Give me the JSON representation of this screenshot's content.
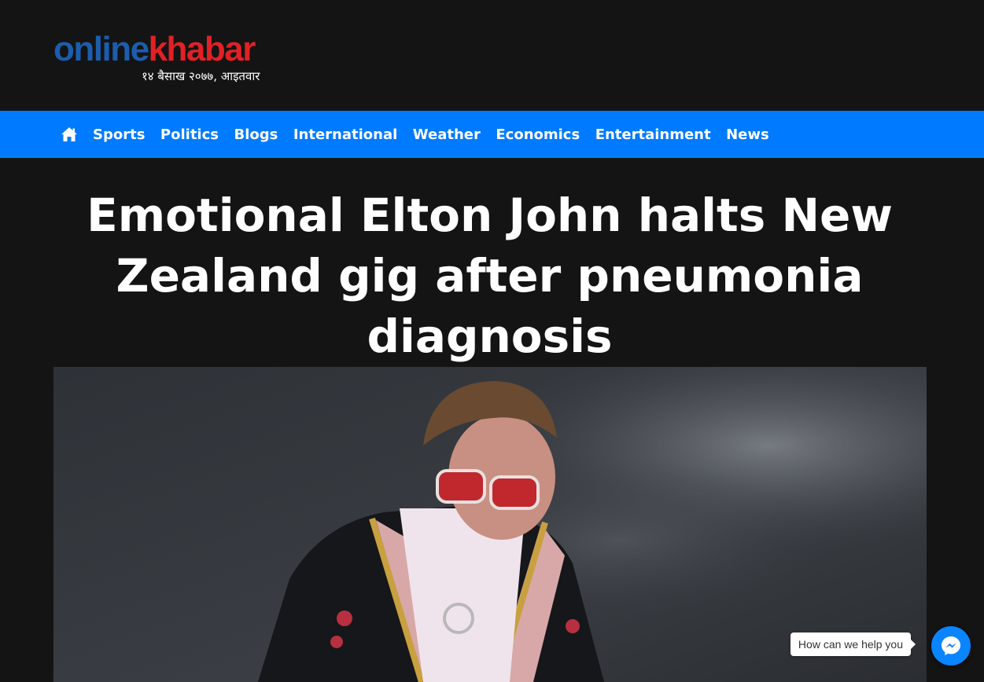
{
  "site": {
    "logo_part1": "online",
    "logo_part2": "khabar",
    "date": "१४ बैसाख २०७७, आइतवार",
    "colors": {
      "logo_blue": "#1c5dac",
      "logo_red": "#e12125",
      "nav_bg": "#007bff",
      "page_bg": "#141414"
    }
  },
  "nav": {
    "home_icon": "home-icon",
    "items": [
      {
        "label": "Sports"
      },
      {
        "label": "Politics"
      },
      {
        "label": "Blogs"
      },
      {
        "label": "International"
      },
      {
        "label": "Weather"
      },
      {
        "label": "Economics"
      },
      {
        "label": "Entertainment"
      },
      {
        "label": "News"
      }
    ]
  },
  "article": {
    "headline": "Emotional Elton John halts New Zealand gig after pneumonia diagnosis",
    "image_subject": "singer in embellished jacket and red sunglasses on stage"
  },
  "chat": {
    "prompt": "How can we help you",
    "icon": "messenger-icon"
  }
}
